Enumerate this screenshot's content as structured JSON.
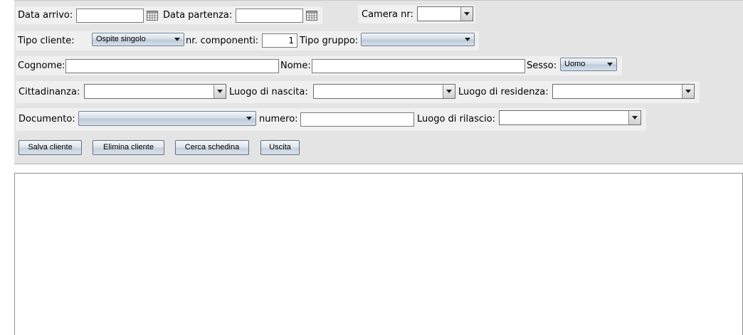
{
  "row1": {
    "data_arrivo_label": "Data arrivo:",
    "data_arrivo_value": "",
    "data_partenza_label": "Data partenza:",
    "data_partenza_value": "",
    "camera_label": "Camera nr:",
    "camera_value": ""
  },
  "row2": {
    "tipo_cliente_label": "Tipo cliente:",
    "tipo_cliente_value": "Ospite singolo",
    "componenti_label": "nr. componenti:",
    "componenti_value": "1",
    "tipo_gruppo_label": "Tipo gruppo:",
    "tipo_gruppo_value": ""
  },
  "row3": {
    "cognome_label": "Cognome:",
    "cognome_value": "",
    "nome_label": "Nome:",
    "nome_value": "",
    "sesso_label": "Sesso:",
    "sesso_value": "Uomo"
  },
  "row4": {
    "cittadinanza_label": "Cittadinanza:",
    "cittadinanza_value": "",
    "luogo_nascita_label": "Luogo di nascita:",
    "luogo_nascita_value": "",
    "luogo_residenza_label": "Luogo di residenza:",
    "luogo_residenza_value": ""
  },
  "row5": {
    "documento_label": "Documento:",
    "documento_value": "",
    "numero_label": "numero:",
    "numero_value": "",
    "luogo_rilascio_label": "Luogo di rilascio:",
    "luogo_rilascio_value": ""
  },
  "buttons": {
    "salva": "Salva cliente",
    "elimina": "Elimina cliente",
    "cerca": "Cerca schedina",
    "uscita": "Uscita"
  }
}
